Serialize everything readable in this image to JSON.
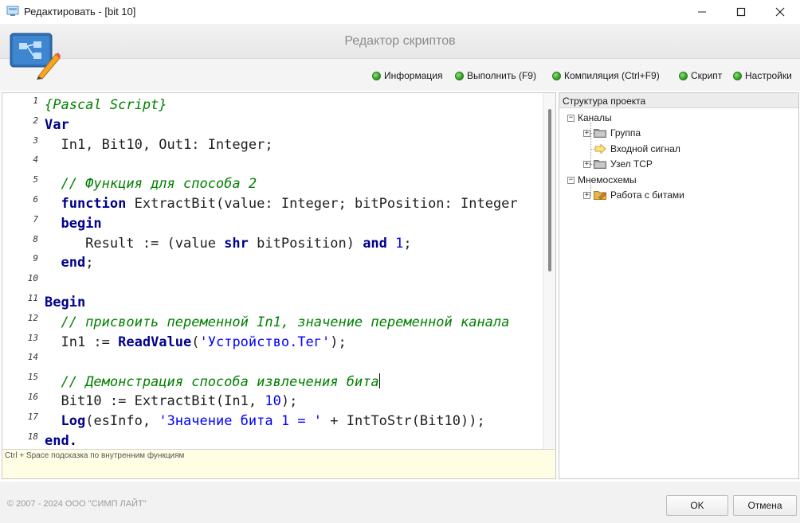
{
  "window": {
    "title": "Редактировать - [bit 10]",
    "minimize_icon": "minimize-icon",
    "maximize_icon": "maximize-icon",
    "close_icon": "close-icon"
  },
  "header": {
    "title": "Редактор скриптов"
  },
  "toolbar": {
    "items": [
      {
        "label": "Информация",
        "icon": "green-dot-icon"
      },
      {
        "label": "Выполнить (F9)",
        "icon": "green-dot-icon"
      },
      {
        "label": "Компиляция (Ctrl+F9)",
        "icon": "green-dot-icon"
      },
      {
        "label": "Скрипт",
        "icon": "green-dot-icon"
      },
      {
        "label": "Настройки",
        "icon": "green-dot-icon"
      }
    ]
  },
  "editor": {
    "line_numbers": [
      "1",
      "2",
      "3",
      "4",
      "5",
      "6",
      "7",
      "8",
      "9",
      "10",
      "11",
      "12",
      "13",
      "14",
      "15",
      "16",
      "17",
      "18"
    ],
    "lines": [
      {
        "parts": [
          {
            "t": "{Pascal Script}",
            "c": "cm"
          }
        ]
      },
      {
        "parts": [
          {
            "t": "Var",
            "c": "kw"
          }
        ]
      },
      {
        "parts": [
          {
            "t": "  In1, Bit10, Out1: Integer;",
            "c": ""
          }
        ]
      },
      {
        "parts": []
      },
      {
        "parts": [
          {
            "t": "  // Функция для способа 2",
            "c": "cm"
          }
        ]
      },
      {
        "parts": [
          {
            "t": "  ",
            "c": ""
          },
          {
            "t": "function",
            "c": "kw"
          },
          {
            "t": " ExtractBit(value: Integer; bitPosition: Integer",
            "c": ""
          }
        ]
      },
      {
        "parts": [
          {
            "t": "  ",
            "c": ""
          },
          {
            "t": "begin",
            "c": "kw"
          }
        ]
      },
      {
        "parts": [
          {
            "t": "     Result := (value ",
            "c": ""
          },
          {
            "t": "shr",
            "c": "kw"
          },
          {
            "t": " bitPosition) ",
            "c": ""
          },
          {
            "t": "and",
            "c": "kw"
          },
          {
            "t": " ",
            "c": ""
          },
          {
            "t": "1",
            "c": "num"
          },
          {
            "t": ";",
            "c": ""
          }
        ]
      },
      {
        "parts": [
          {
            "t": "  ",
            "c": ""
          },
          {
            "t": "end",
            "c": "kw"
          },
          {
            "t": ";",
            "c": ""
          }
        ]
      },
      {
        "parts": []
      },
      {
        "parts": [
          {
            "t": "Begin",
            "c": "kw"
          }
        ]
      },
      {
        "parts": [
          {
            "t": "  // присвоить переменной In1, значение переменной канала",
            "c": "cm"
          }
        ]
      },
      {
        "parts": [
          {
            "t": "  In1 := ",
            "c": ""
          },
          {
            "t": "ReadValue",
            "c": "kw"
          },
          {
            "t": "(",
            "c": ""
          },
          {
            "t": "'Устройство.Тег'",
            "c": "str"
          },
          {
            "t": ");",
            "c": ""
          }
        ]
      },
      {
        "parts": []
      },
      {
        "parts": [
          {
            "t": "  // Демонстрация способа извлечения бита",
            "c": "cm"
          },
          {
            "t": "",
            "c": "caret"
          }
        ]
      },
      {
        "parts": [
          {
            "t": "  Bit10 := ExtractBit(In1, ",
            "c": ""
          },
          {
            "t": "10",
            "c": "num"
          },
          {
            "t": ");",
            "c": ""
          }
        ]
      },
      {
        "parts": [
          {
            "t": "  ",
            "c": ""
          },
          {
            "t": "Log",
            "c": "kw"
          },
          {
            "t": "(esInfo, ",
            "c": ""
          },
          {
            "t": "'Значение бита 1 = '",
            "c": "str"
          },
          {
            "t": " + IntToStr(Bit10));",
            "c": ""
          }
        ]
      },
      {
        "parts": [
          {
            "t": "end.",
            "c": "kw"
          }
        ]
      }
    ],
    "hint": "Ctrl + Space подсказка по внутренним функциям"
  },
  "project_tree": {
    "header": "Структура проекта",
    "channels_label": "Каналы",
    "group_label": "Группа",
    "input_signal_label": "Входной сигнал",
    "tcp_node_label": "Узел TCP",
    "mnemo_label": "Мнемосхемы",
    "bits_label": "Работа с битами"
  },
  "footer": {
    "copyright": "© 2007 - 2024  ООО \"СИМП ЛАЙТ\"",
    "ok_label": "OK",
    "cancel_label": "Отмена"
  }
}
